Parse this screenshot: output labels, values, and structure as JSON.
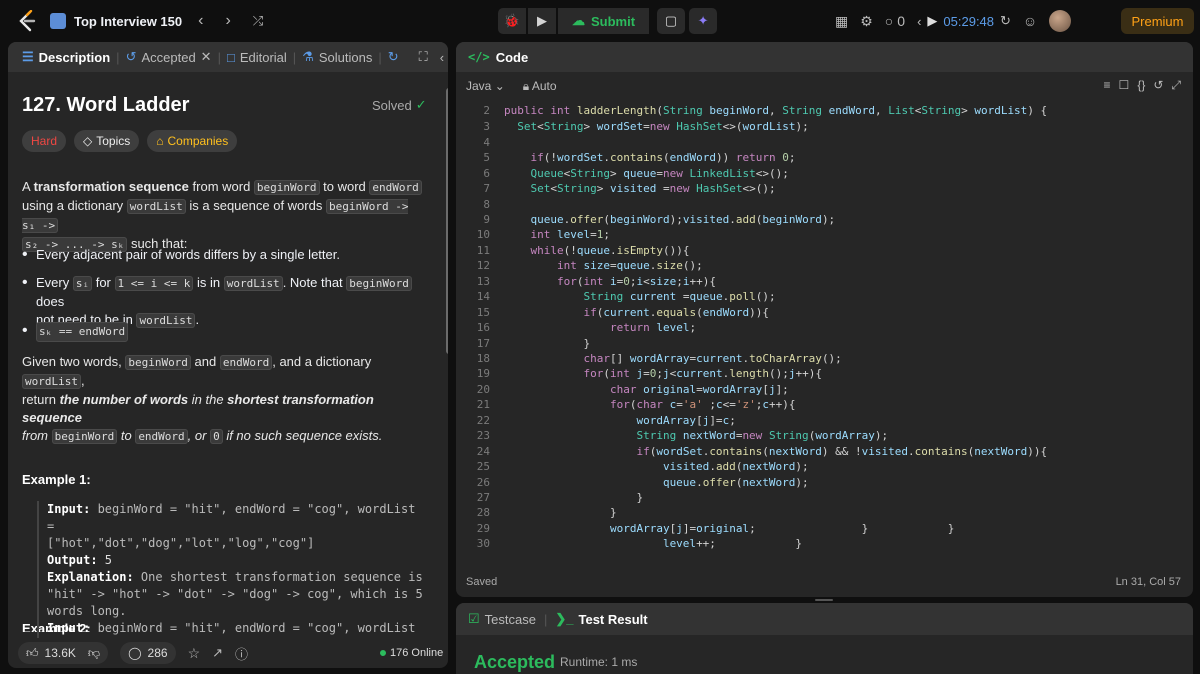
{
  "topbar": {
    "list_title": "Top Interview 150",
    "submit_label": "Submit",
    "streak_count": "0",
    "timer": "05:29:48",
    "premium_label": "Premium"
  },
  "left_tabs": {
    "description": "Description",
    "accepted": "Accepted",
    "editorial": "Editorial",
    "solutions": "Solutions"
  },
  "problem": {
    "title": "127. Word Ladder",
    "status": "Solved",
    "difficulty": "Hard",
    "topics": "Topics",
    "companies": "Companies",
    "p1_a": "A ",
    "p1_bold": "transformation sequence",
    "p1_b": " from word ",
    "p1_c1": "beginWord",
    "p1_d": " to word ",
    "p1_c2": "endWord",
    "p2_a": "using a dictionary ",
    "p2_c1": "wordList",
    "p2_b": " is a sequence of words ",
    "p2_c2": "beginWord -> s₁ ->",
    "p3_c1": "s₂ -> ... -> sₖ",
    "p3_a": " such that:",
    "b1": "Every adjacent pair of words differs by a single letter.",
    "b2_a": "Every ",
    "b2_c1": "sᵢ",
    "b2_b": " for ",
    "b2_c2": "1 <= i <= k",
    "b2_c": " is in ",
    "b2_c3": "wordList",
    "b2_d": ". Note that ",
    "b2_c4": "beginWord",
    "b2_e": " does",
    "b2_f": "not need to be in ",
    "b2_c5": "wordList",
    "b2_g": ".",
    "b3_c1": "sₖ == endWord",
    "q1_a": "Given two words, ",
    "q1_c1": "beginWord",
    "q1_b": " and ",
    "q1_c2": "endWord",
    "q1_c": ", and a dictionary ",
    "q1_c3": "wordList",
    "q1_d": ",",
    "q2_a": "return ",
    "q2_bold": "the number of words",
    "q2_b": " in the ",
    "q2_bold2": "shortest transformation sequence",
    "q3_a": "from ",
    "q3_c1": "beginWord",
    "q3_b": " to ",
    "q3_c2": "endWord",
    "q3_c": ", or ",
    "q3_c3": "0",
    "q3_d": " if no such sequence exists.",
    "example1_title": "Example 1:",
    "ex1_input_label": "Input:",
    "ex1_input_a": " beginWord = \"hit\", endWord = \"cog\", wordList =",
    "ex1_input_b": "[\"hot\",\"dot\",\"dog\",\"lot\",\"log\",\"cog\"]",
    "ex1_output_label": "Output:",
    "ex1_output": " 5",
    "ex1_expl_label": "Explanation:",
    "ex1_expl_a": " One shortest transformation sequence is",
    "ex1_expl_b": "\"hit\" -> \"hot\" -> \"dot\" -> \"dog\" -> cog\", which is 5",
    "ex1_expl_c": "words long.",
    "example2_title": "Example 2:",
    "ex2_input_label": "Input:",
    "ex2_input_a": " beginWord = \"hit\", endWord = \"cog\", wordList ="
  },
  "footer": {
    "likes": "13.6K",
    "comments": "286",
    "online": "176 Online"
  },
  "code": {
    "header": "Code",
    "language": "Java",
    "mode": "Auto",
    "status": "Saved",
    "cursor": "Ln 31, Col 57",
    "line_numbers": [
      "2",
      "3",
      "4",
      "5",
      "6",
      "7",
      "8",
      "9",
      "10",
      "11",
      "12",
      "13",
      "14",
      "15",
      "16",
      "17",
      "18",
      "19",
      "20",
      "21",
      "22",
      "23",
      "24",
      "25",
      "26",
      "27",
      "28",
      "29",
      "30"
    ]
  },
  "result": {
    "testcase_tab": "Testcase",
    "result_tab": "Test Result",
    "verdict": "Accepted",
    "runtime": "Runtime: 1 ms"
  },
  "colors": {
    "accent_green": "#2cbb5d",
    "hard_red": "#ef4743",
    "premium_orange": "#ffa116",
    "timer_blue": "#5c9ce8"
  }
}
